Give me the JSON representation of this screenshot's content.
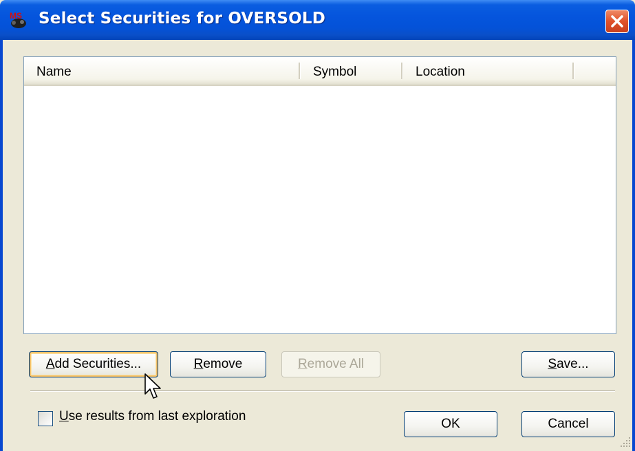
{
  "window": {
    "title": "Select Securities for OVERSOLD",
    "app_icon": "ms-app-icon",
    "close_icon": "close-icon"
  },
  "list": {
    "columns": [
      "Name",
      "Symbol",
      "Location"
    ],
    "rows": []
  },
  "buttons": {
    "add_securities": {
      "prefix": "",
      "accel": "A",
      "rest": "dd Securities..."
    },
    "remove": {
      "prefix": "",
      "accel": "R",
      "rest": "emove"
    },
    "remove_all": {
      "prefix": "",
      "accel": "R",
      "rest": "emove All",
      "disabled": true
    },
    "save": {
      "prefix": "",
      "accel": "S",
      "rest": "ave..."
    },
    "ok": "OK",
    "cancel": "Cancel"
  },
  "options": {
    "use_results": {
      "accel": "U",
      "rest": "se results from last exploration",
      "checked": false
    }
  },
  "colors": {
    "titlebar": "#0555dd",
    "dialog_bg": "#ece9d8",
    "close_red": "#e0522b",
    "default_focus": "#f5c26a"
  }
}
